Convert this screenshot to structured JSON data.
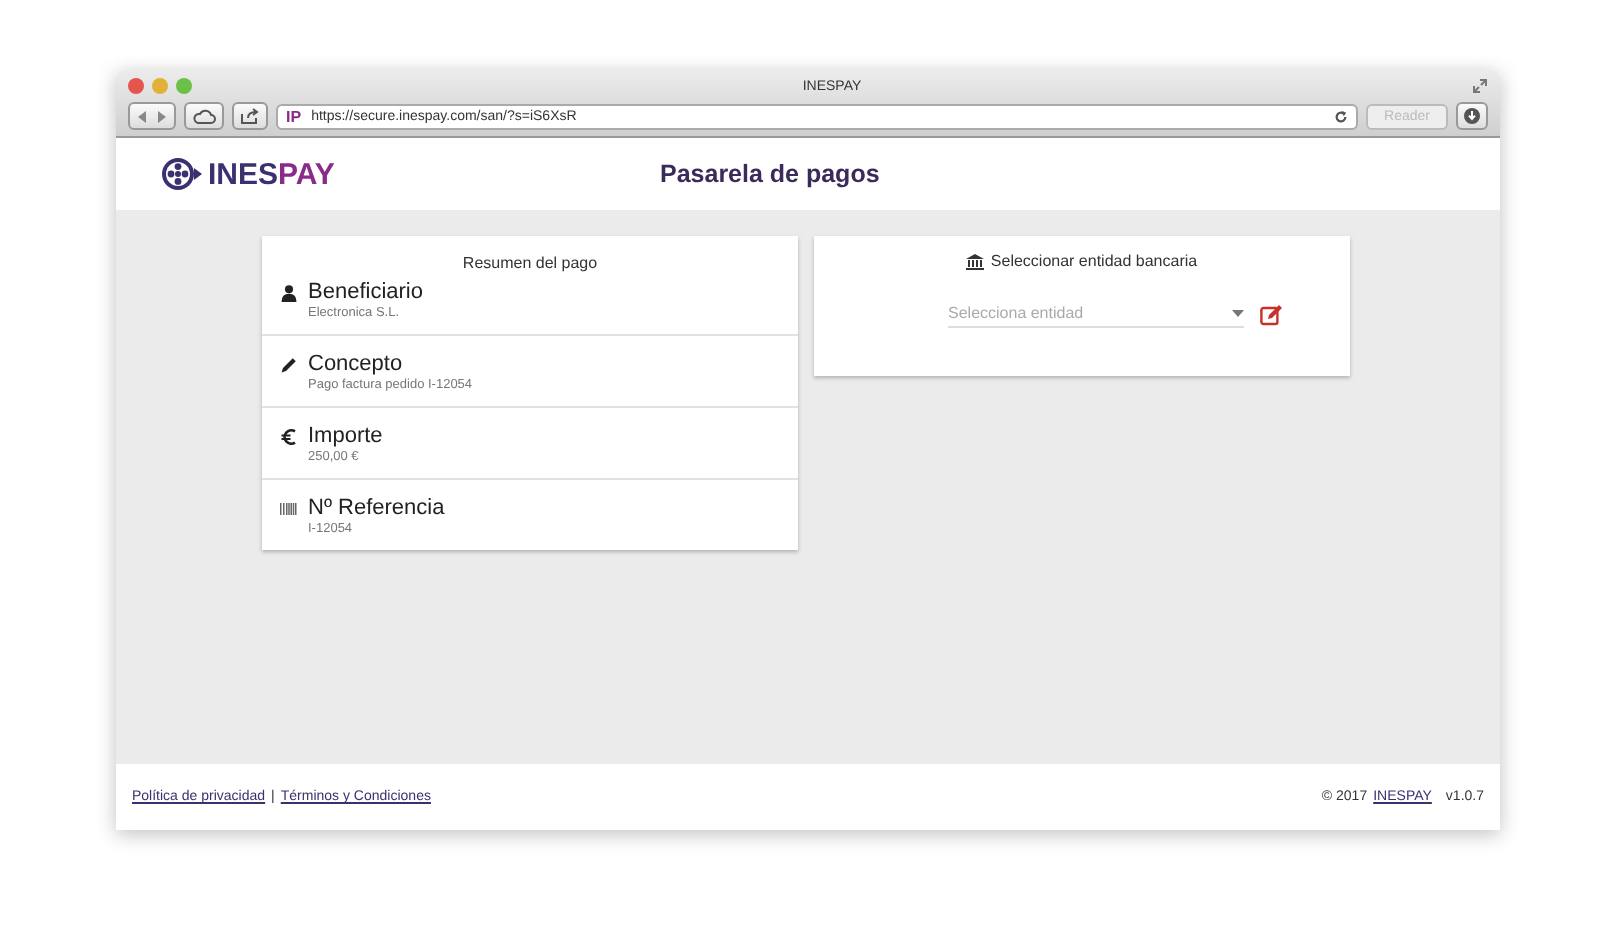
{
  "window": {
    "title": "INESPAY"
  },
  "toolbar": {
    "site_badge": "IP",
    "url": "https://secure.inespay.com/san/?s=iS6XsR",
    "reader_button": "Reader"
  },
  "header": {
    "logo_prefix": "INES",
    "logo_suffix": "PAY",
    "title": "Pasarela de pagos"
  },
  "summary": {
    "title": "Resumen del pago",
    "items": [
      {
        "kind": "person",
        "label": "Beneficiario",
        "value": "Electronica S.L."
      },
      {
        "kind": "pencil",
        "label": "Concepto",
        "value": "Pago factura pedido I-12054"
      },
      {
        "kind": "euro",
        "label": "Importe",
        "value": "250,00 €"
      },
      {
        "kind": "barcode",
        "label": "Nº Referencia",
        "value": "I-12054"
      }
    ]
  },
  "bank": {
    "title": "Seleccionar entidad bancaria",
    "select": {
      "placeholder": "Selecciona entidad"
    }
  },
  "footer": {
    "links": [
      "Política de privacidad",
      "Términos y Condiciones"
    ],
    "separator": "|",
    "copyright": "© 2017",
    "brand_link": "INESPAY",
    "version": "v1.0.7"
  }
}
